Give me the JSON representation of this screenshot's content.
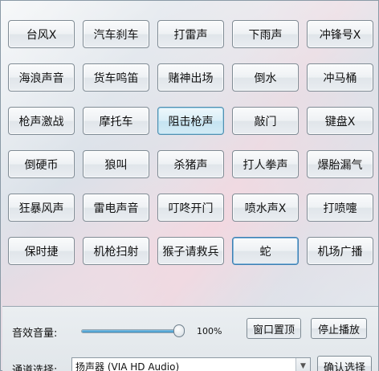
{
  "sound_buttons": [
    "台风X",
    "汽车刹车",
    "打雷声",
    "下雨声",
    "冲锋号X",
    "海浪声音",
    "货车鸣笛",
    "赌神出场",
    "倒水",
    "冲马桶",
    "枪声激战",
    "摩托车",
    "阻击枪声",
    "敲门",
    "键盘X",
    "倒硬币",
    "狼叫",
    "杀猪声",
    "打人拳声",
    "爆胎漏气",
    "狂暴风声",
    "雷电声音",
    "叮咚开门",
    "喷水声X",
    "打喷嚏",
    "保时捷",
    "机枪扫射",
    "猴子请救兵",
    "蛇",
    "机场广播"
  ],
  "focused_button_index": 12,
  "selected_button_index": 28,
  "volume": {
    "label": "音效音量:",
    "value_text": "100%",
    "level": 1.0
  },
  "pin_button_label": "窗口置顶",
  "stop_button_label": "停止播放",
  "channel": {
    "label": "通道选择:",
    "selected": "扬声器 (VIA HD Audio)"
  },
  "confirm_button_label": "确认选择",
  "colors": {
    "slider_fill": "#3b93c7",
    "focused_border": "#4f8fb0"
  }
}
